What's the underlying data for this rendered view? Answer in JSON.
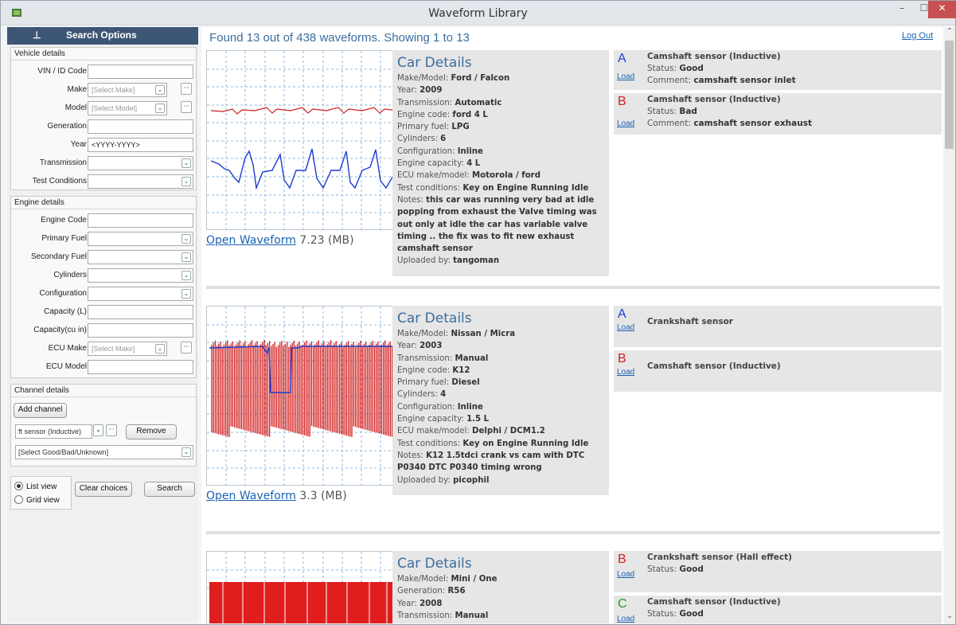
{
  "window": {
    "title": "Waveform Library"
  },
  "sidebar": {
    "header": "Search Options",
    "vehicle": {
      "title": "Vehicle details",
      "fields": [
        {
          "label": "VIN / ID Code",
          "value": ""
        },
        {
          "label": "Make",
          "value": "[Select Make]"
        },
        {
          "label": "Model",
          "value": "[Select Model]"
        },
        {
          "label": "Generation",
          "value": ""
        },
        {
          "label": "Year",
          "value": "<YYYY-YYYY>"
        },
        {
          "label": "Transmission",
          "value": ""
        },
        {
          "label": "Test Conditions",
          "value": ""
        }
      ]
    },
    "engine": {
      "title": "Engine details",
      "fields": [
        {
          "label": "Engine Code",
          "value": ""
        },
        {
          "label": "Primary Fuel",
          "value": ""
        },
        {
          "label": "Secondary Fuel",
          "value": ""
        },
        {
          "label": "Cylinders",
          "value": ""
        },
        {
          "label": "Configuration",
          "value": ""
        },
        {
          "label": "Capacity (L)",
          "value": ""
        },
        {
          "label": "Capacity(cu in)",
          "value": ""
        },
        {
          "label": "ECU Make",
          "value": "[Select Make]"
        },
        {
          "label": "ECU Model",
          "value": ""
        }
      ]
    },
    "channel": {
      "title": "Channel details",
      "add_label": "Add channel",
      "channel_value": "ft sensor (Inductive)",
      "remove_label": "Remove",
      "status_value": "[Select Good/Bad/Unknown]"
    },
    "view": {
      "list_label": "List view",
      "grid_label": "Grid view",
      "selected": "List view"
    },
    "clear_label": "Clear choices",
    "search_label": "Search"
  },
  "main": {
    "results_text": "Found 13 out of 438 waveforms. Showing 1 to 13",
    "logout_label": "Log Out",
    "results": [
      {
        "open_label": "Open Waveform",
        "size": "7.23 (MB)",
        "details_title": "Car Details",
        "details": [
          {
            "k": "Make/Model: ",
            "v": "Ford / Falcon"
          },
          {
            "k": "Year: ",
            "v": "2009"
          },
          {
            "k": "Transmission: ",
            "v": "Automatic"
          },
          {
            "k": "Engine code: ",
            "v": "ford 4 L"
          },
          {
            "k": "Primary fuel: ",
            "v": "LPG"
          },
          {
            "k": "Cylinders: ",
            "v": "6"
          },
          {
            "k": "Configuration: ",
            "v": "Inline"
          },
          {
            "k": "Engine capacity: ",
            "v": "4 L"
          },
          {
            "k": "ECU make/model: ",
            "v": "Motorola / ford"
          },
          {
            "k": "Test conditions: ",
            "v": "Key on Engine Running Idle"
          },
          {
            "k": "Notes: ",
            "v": "this car was running very bad at idle popping from exhaust the Valve timing was out only at idle the car has variable valve timing .. the fix was to fit new exhaust camshaft sensor"
          },
          {
            "k": "Uploaded by: ",
            "v": "tangoman"
          }
        ],
        "channels": [
          {
            "letter": "A",
            "color": "#1e3cd0",
            "name": "Camshaft sensor (Inductive)",
            "load": "Load",
            "status": "Good",
            "comment": "camshaft sensor inlet"
          },
          {
            "letter": "B",
            "color": "#d21e1e",
            "name": "Camshaft sensor (Inductive)",
            "load": "Load",
            "status": "Bad",
            "comment": "camshaft sensor exhaust"
          }
        ]
      },
      {
        "open_label": "Open Waveform",
        "size": "3.3 (MB)",
        "details_title": "Car Details",
        "details": [
          {
            "k": "Make/Model: ",
            "v": "Nissan / Micra"
          },
          {
            "k": "Year: ",
            "v": "2003"
          },
          {
            "k": "Transmission: ",
            "v": "Manual"
          },
          {
            "k": "Engine code: ",
            "v": "K12"
          },
          {
            "k": "Primary fuel: ",
            "v": "Diesel"
          },
          {
            "k": "Cylinders: ",
            "v": "4"
          },
          {
            "k": "Configuration: ",
            "v": "Inline"
          },
          {
            "k": "Engine capacity: ",
            "v": "1.5 L"
          },
          {
            "k": "ECU make/model: ",
            "v": "Delphi / DCM1.2"
          },
          {
            "k": "Test conditions: ",
            "v": "Key on Engine Running Idle"
          },
          {
            "k": "Notes: ",
            "v": "K12 1.5tdci crank vs cam with DTC P0340 DTC P0340 timing wrong"
          },
          {
            "k": "Uploaded by: ",
            "v": "picophil"
          }
        ],
        "channels": [
          {
            "letter": "A",
            "color": "#1e3cd0",
            "name": "Crankshaft sensor",
            "load": "Load"
          },
          {
            "letter": "B",
            "color": "#d21e1e",
            "name": "Camshaft sensor (Inductive)",
            "load": "Load"
          }
        ]
      },
      {
        "details_title": "Car Details",
        "details": [
          {
            "k": "Make/Model: ",
            "v": "Mini / One"
          },
          {
            "k": "Generation: ",
            "v": "R56"
          },
          {
            "k": "Year: ",
            "v": "2008"
          },
          {
            "k": "Transmission: ",
            "v": "Manual"
          }
        ],
        "channels": [
          {
            "letter": "B",
            "color": "#d21e1e",
            "name": "Crankshaft sensor (Hall effect)",
            "load": "Load",
            "status": "Good"
          },
          {
            "letter": "C",
            "color": "#23a023",
            "name": "Camshaft sensor (Inductive)",
            "load": "Load",
            "status": "Good"
          }
        ]
      }
    ]
  },
  "colors": {
    "accent": "#3e5676",
    "link": "#1b62b3",
    "heading": "#3b6d9e",
    "close": "#c75050"
  }
}
